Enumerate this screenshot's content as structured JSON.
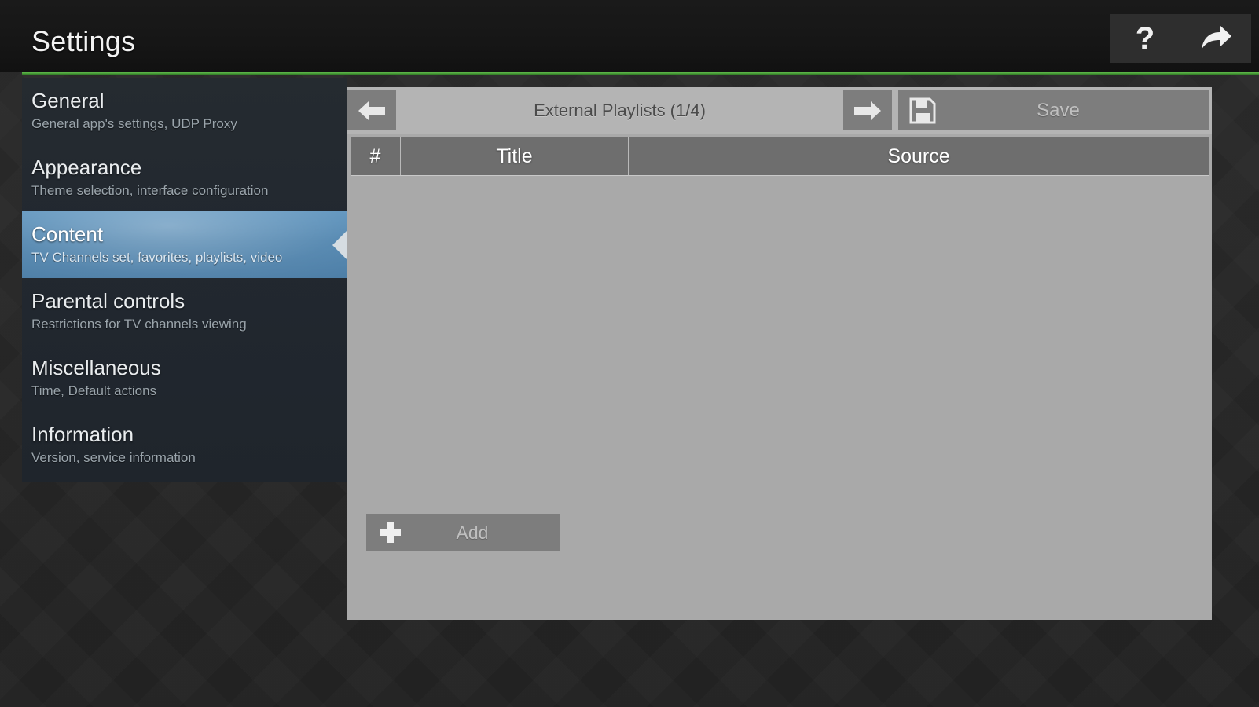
{
  "header": {
    "title": "Settings",
    "help_label": "?",
    "help_icon": "question-mark-icon",
    "exit_icon": "curved-arrow-right-icon",
    "accent_color": "#3d8c2f"
  },
  "sidebar": {
    "items": [
      {
        "title": "General",
        "subtitle": "General app's settings, UDP Proxy",
        "selected": false
      },
      {
        "title": "Appearance",
        "subtitle": "Theme selection, interface configuration",
        "selected": false
      },
      {
        "title": "Content",
        "subtitle": "TV Channels set, favorites, playlists, video",
        "selected": true
      },
      {
        "title": "Parental controls",
        "subtitle": "Restrictions for TV channels viewing",
        "selected": false
      },
      {
        "title": "Miscellaneous",
        "subtitle": "Time, Default actions",
        "selected": false
      },
      {
        "title": "Information",
        "subtitle": "Version, service information",
        "selected": false
      }
    ],
    "selected_color": "#4f84ae"
  },
  "panel": {
    "toolbar": {
      "prev_icon": "arrow-left-icon",
      "title": "External Playlists (1/4)",
      "page_current": "1",
      "page_total": "4",
      "next_icon": "arrow-right-icon",
      "save_icon": "floppy-disk-icon",
      "save_label": "Save"
    },
    "table": {
      "columns": [
        "#",
        "Title",
        "Source"
      ],
      "rows": []
    },
    "add_button": {
      "icon": "plus-icon",
      "label": "Add"
    }
  }
}
